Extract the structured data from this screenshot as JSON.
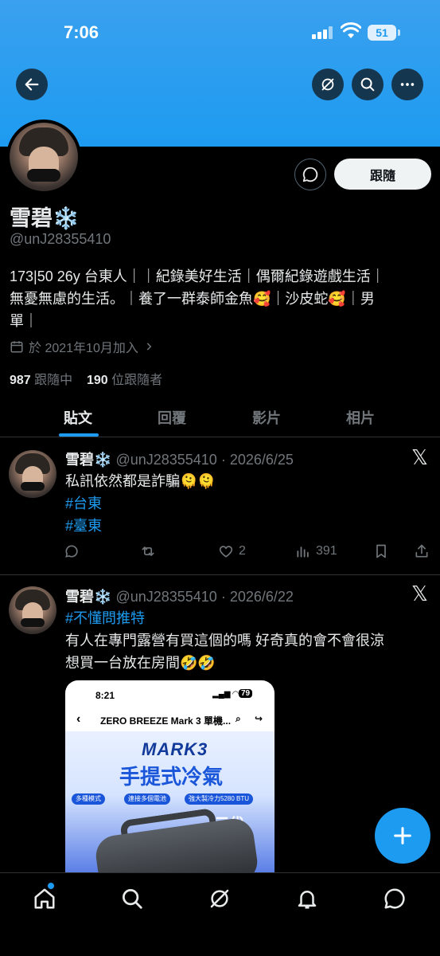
{
  "status_bar": {
    "time": "7:06",
    "battery": "51"
  },
  "profile": {
    "display_name": "雪碧❄️",
    "handle": "@unJ28355410",
    "bio_line1": "173|50 26y 台東人｜｜紀錄美好生活｜偶爾紀錄遊戲生活｜",
    "bio_line2": "無憂無慮的生活。｜養了一群泰師金魚🥰｜沙皮蛇🥰｜男",
    "bio_line3": "單｜",
    "joined": "於 2021年10月加入",
    "following_count": "987",
    "following_label": "跟隨中",
    "followers_count": "190",
    "followers_label": "位跟隨者",
    "follow_button": "跟隨"
  },
  "tabs": [
    {
      "label": "貼文",
      "active": true
    },
    {
      "label": "回覆",
      "active": false
    },
    {
      "label": "影片",
      "active": false
    },
    {
      "label": "相片",
      "active": false
    }
  ],
  "posts": [
    {
      "name": "雪碧❄️",
      "meta": "@unJ28355410 · 2026/6/25",
      "text_line1": "私訊依然都是詐騙🫠🫠",
      "hashtag1": "#台東",
      "hashtag2": "#臺東",
      "likes": "2",
      "views": "391"
    },
    {
      "name": "雪碧❄️",
      "meta": "@unJ28355410 · 2026/6/22",
      "hashtag1": "#不懂問推特",
      "text_line1": "有人在專門露營有買這個的嗎 好奇真的會不會很涼",
      "text_line2": "想買一台放在房間🤣🤣",
      "embed": {
        "time": "8:21",
        "battery": "79",
        "title": "ZERO BREEZE Mark 3 單機...",
        "brand": "MARK3",
        "headline": "手提式冷氣",
        "pill1": "多種模式",
        "pill2": "連接多個電池",
        "pill3": "強大製冷力5280 BTU",
        "tag": "三代"
      }
    }
  ],
  "accent_color": "#1d9bf0"
}
